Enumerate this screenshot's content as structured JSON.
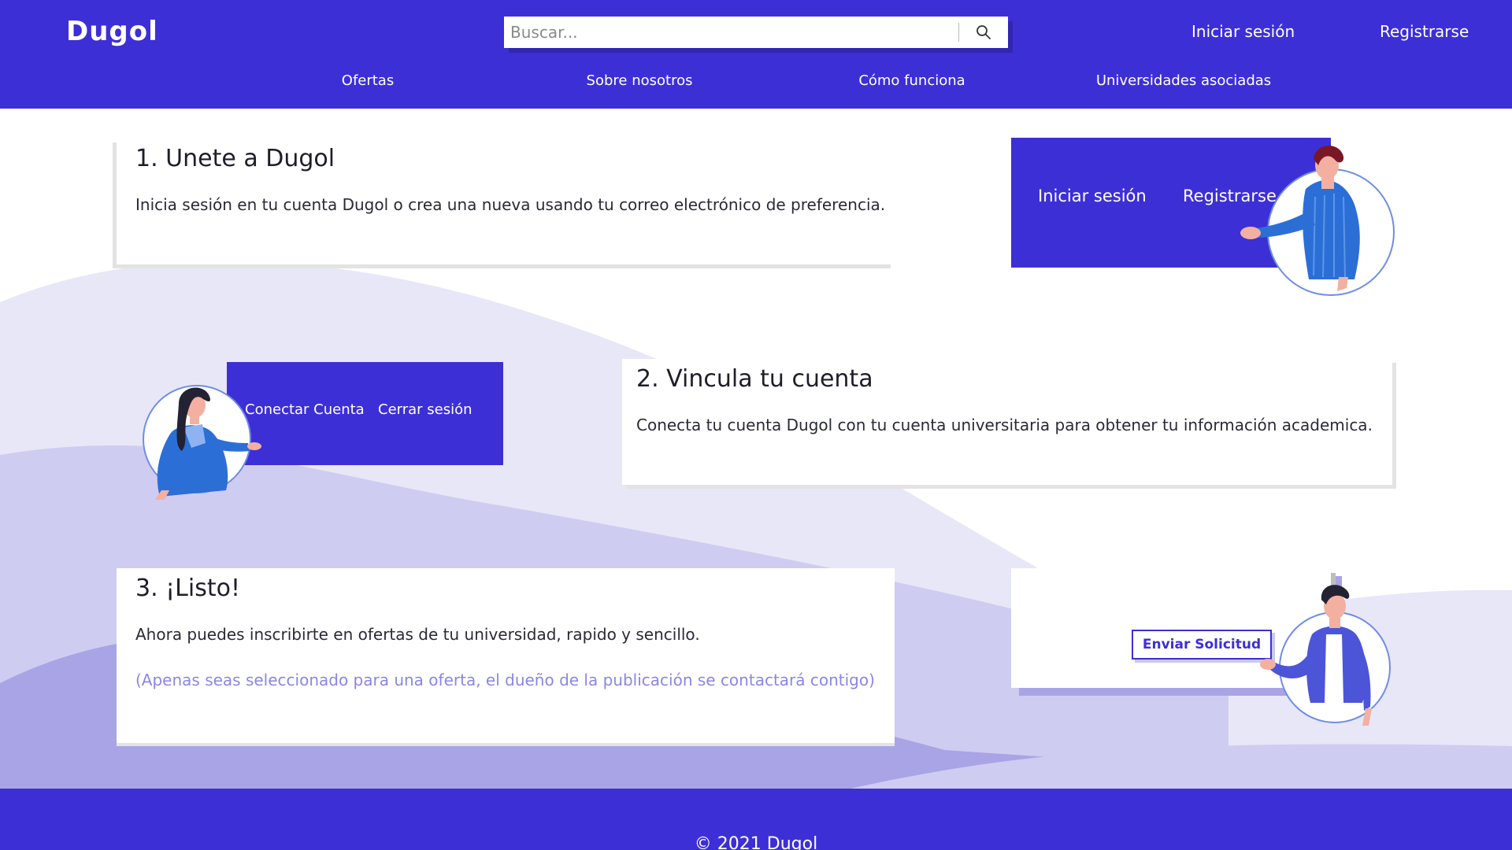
{
  "header": {
    "logo": "Dugol",
    "search_placeholder": "Buscar...",
    "login": "Iniciar sesión",
    "register": "Registrarse",
    "nav": [
      "Ofertas",
      "Sobre nosotros",
      "Cómo funciona",
      "Universidades asociadas"
    ]
  },
  "steps": [
    {
      "title": "1. Unete a Dugol",
      "text": "Inicia sesión en tu cuenta Dugol o crea una nueva usando tu correo electrónico de preferencia.",
      "panel": {
        "login": "Iniciar sesión",
        "register": "Registrarse"
      }
    },
    {
      "title": "2. Vincula tu cuenta",
      "text": "Conecta tu cuenta Dugol con tu cuenta universitaria para obtener tu información academica.",
      "panel": {
        "connect": "Conectar Cuenta",
        "logout": "Cerrar sesión"
      }
    },
    {
      "title": "3. ¡Listo!",
      "text": "Ahora puedes inscribirte en ofertas de tu universidad, rapido y sencillo.",
      "note": "(Apenas seas seleccionado para una oferta, el dueño de la publicación se contactará contigo)",
      "panel": {
        "send": "Enviar Solicitud"
      }
    }
  ],
  "footer": {
    "text": "© 2021 Dugol"
  },
  "colors": {
    "brand": "#3d2fd6",
    "note": "#8b86e6",
    "wave_light": "#e8e7f8",
    "wave_mid": "#cfccf1",
    "wave_dark": "#a9a4e5"
  },
  "icons": [
    "search-icon",
    "man-illustration-icon",
    "woman-illustration-icon",
    "person-illustration-icon"
  ]
}
